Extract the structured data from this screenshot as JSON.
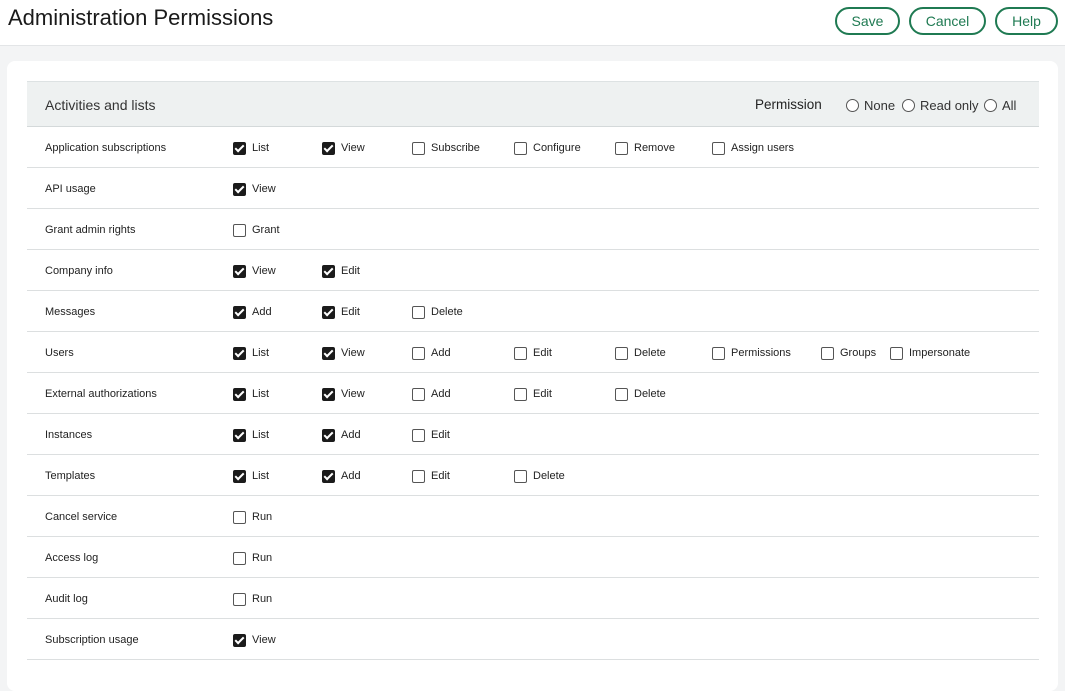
{
  "header": {
    "title": "Administration Permissions",
    "save_label": "Save",
    "cancel_label": "Cancel",
    "help_label": "Help"
  },
  "section": {
    "title": "Activities and lists",
    "permission_label": "Permission",
    "options": [
      "None",
      "Read only",
      "All"
    ]
  },
  "colors": {
    "accent": "#1f7a52",
    "header_band": "#eef1f1"
  },
  "rows": [
    {
      "label": "Application subscriptions",
      "perms": [
        {
          "label": "List",
          "checked": true
        },
        {
          "label": "View",
          "checked": true
        },
        {
          "label": "Subscribe",
          "checked": false
        },
        {
          "label": "Configure",
          "checked": false
        },
        {
          "label": "Remove",
          "checked": false
        },
        {
          "label": "Assign users",
          "checked": false
        }
      ]
    },
    {
      "label": "API usage",
      "perms": [
        {
          "label": "View",
          "checked": true
        }
      ]
    },
    {
      "label": "Grant admin rights",
      "perms": [
        {
          "label": "Grant",
          "checked": false
        }
      ]
    },
    {
      "label": "Company info",
      "perms": [
        {
          "label": "View",
          "checked": true
        },
        {
          "label": "Edit",
          "checked": true
        }
      ]
    },
    {
      "label": "Messages",
      "perms": [
        {
          "label": "Add",
          "checked": true
        },
        {
          "label": "Edit",
          "checked": true
        },
        {
          "label": "Delete",
          "checked": false
        }
      ]
    },
    {
      "label": "Users",
      "perms": [
        {
          "label": "List",
          "checked": true
        },
        {
          "label": "View",
          "checked": true
        },
        {
          "label": "Add",
          "checked": false
        },
        {
          "label": "Edit",
          "checked": false
        },
        {
          "label": "Delete",
          "checked": false
        },
        {
          "label": "Permissions",
          "checked": false
        },
        {
          "label": "Groups",
          "checked": false
        },
        {
          "label": "Impersonate",
          "checked": false
        }
      ]
    },
    {
      "label": "External authorizations",
      "perms": [
        {
          "label": "List",
          "checked": true
        },
        {
          "label": "View",
          "checked": true
        },
        {
          "label": "Add",
          "checked": false
        },
        {
          "label": "Edit",
          "checked": false
        },
        {
          "label": "Delete",
          "checked": false
        }
      ]
    },
    {
      "label": "Instances",
      "perms": [
        {
          "label": "List",
          "checked": true
        },
        {
          "label": "Add",
          "checked": true
        },
        {
          "label": "Edit",
          "checked": false
        }
      ]
    },
    {
      "label": "Templates",
      "perms": [
        {
          "label": "List",
          "checked": true
        },
        {
          "label": "Add",
          "checked": true
        },
        {
          "label": "Edit",
          "checked": false
        },
        {
          "label": "Delete",
          "checked": false
        }
      ]
    },
    {
      "label": "Cancel service",
      "perms": [
        {
          "label": "Run",
          "checked": false
        }
      ]
    },
    {
      "label": "Access log",
      "perms": [
        {
          "label": "Run",
          "checked": false
        }
      ]
    },
    {
      "label": "Audit log",
      "perms": [
        {
          "label": "Run",
          "checked": false
        }
      ]
    },
    {
      "label": "Subscription usage",
      "perms": [
        {
          "label": "View",
          "checked": true
        }
      ]
    }
  ]
}
